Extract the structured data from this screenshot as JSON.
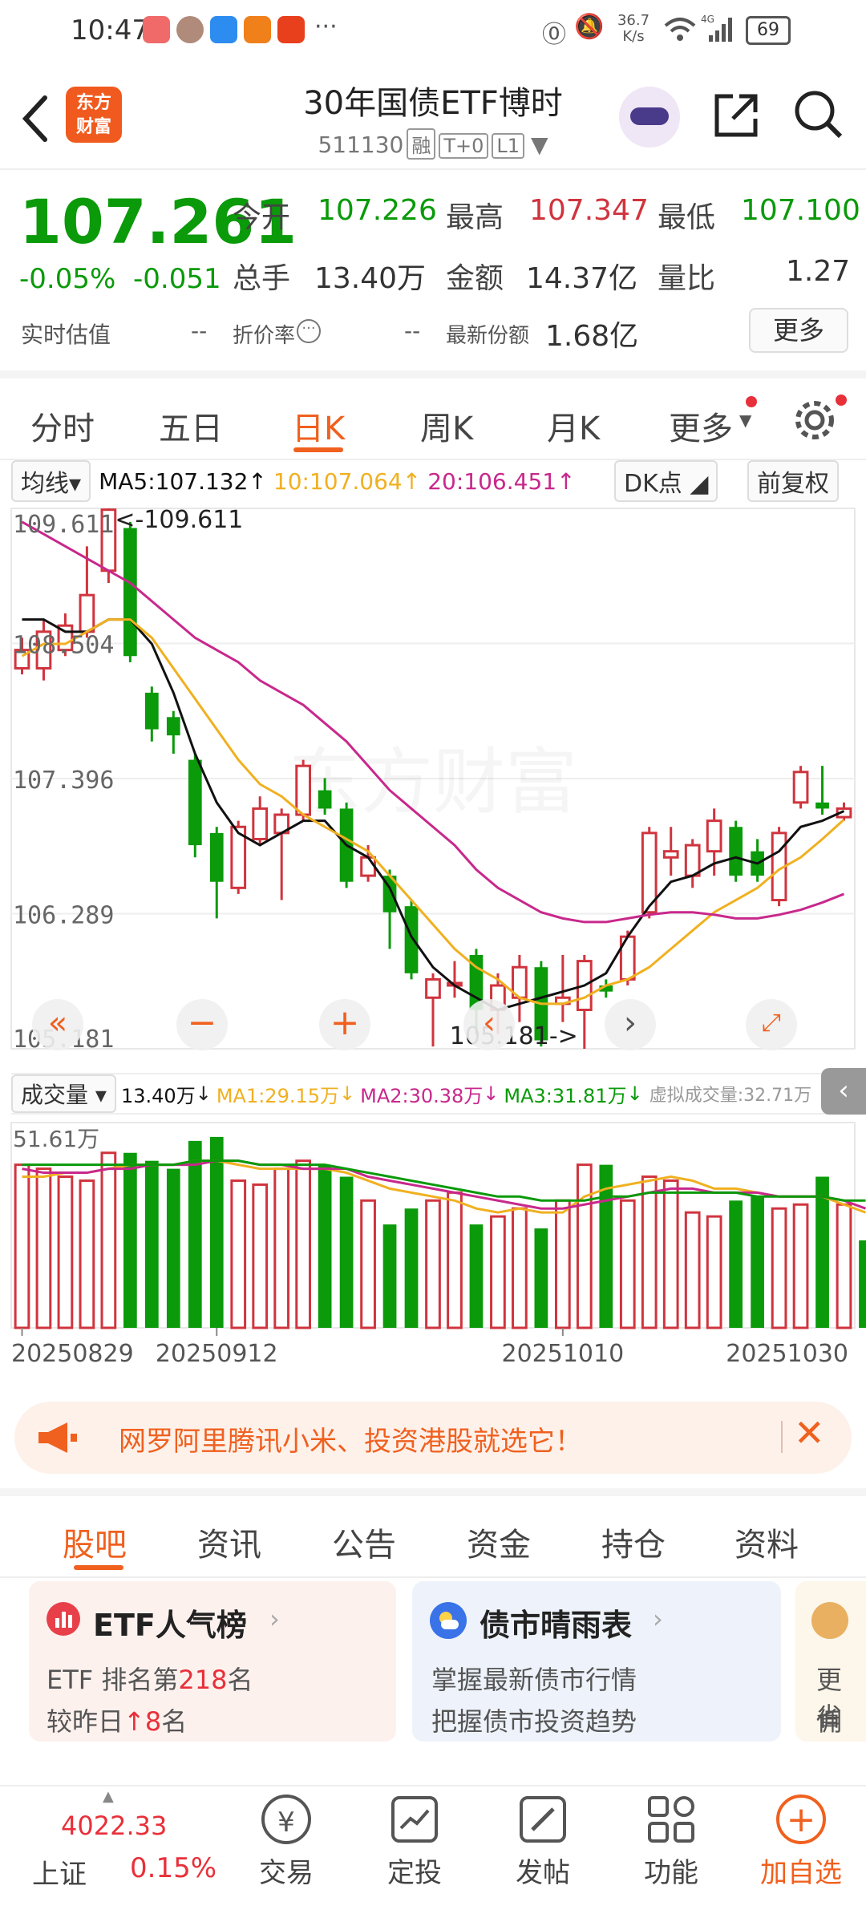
{
  "status_bar": {
    "time": "10:47",
    "net_speed_value": "36.7",
    "net_speed_unit": "K/s",
    "battery": "69"
  },
  "header": {
    "app_badge_line1": "东方",
    "app_badge_line2": "财富",
    "title": "30年国债ETF博时",
    "code": "511130",
    "tag1": "融",
    "tag2": "T+0",
    "tag3": "L1"
  },
  "quote": {
    "price": "107.261",
    "change_pct": "-0.05%",
    "change": "-0.051",
    "open_label": "今开",
    "open": "107.226",
    "high_label": "最高",
    "high": "107.347",
    "low_label": "最低",
    "low": "107.100",
    "volume_label": "总手",
    "volume": "13.40万",
    "amount_label": "金额",
    "amount": "14.37亿",
    "ratio_label": "量比",
    "ratio": "1.27",
    "estimate_label": "实时估值",
    "estimate": "--",
    "discount_label": "折价率",
    "discount": "--",
    "shares_label": "最新份额",
    "shares": "1.68亿",
    "more": "更多"
  },
  "chart_tabs": [
    "分时",
    "五日",
    "日K",
    "周K",
    "月K",
    "更多"
  ],
  "active_tab": 2,
  "kline_bar": {
    "ma_select": "均线",
    "ma5": "MA5:107.132",
    "ma10": "10:107.064",
    "ma20": "20:106.451",
    "dk": "DK点",
    "adjust": "前复权"
  },
  "volume_bar": {
    "select": "成交量",
    "vol": "13.40万",
    "ma1": "MA1:29.15万",
    "ma2": "MA2:30.38万",
    "ma3": "MA3:31.81万",
    "virtual": "虚拟成交量:32.71万"
  },
  "chart_data": {
    "type": "candlestick",
    "y_ticks": [
      "109.611",
      "108.504",
      "107.396",
      "106.289",
      "105.181"
    ],
    "ylim": [
      105.181,
      109.611
    ],
    "max_label": "<-109.611",
    "min_label": "105.181->",
    "vol_max_label": "51.61万",
    "vol_ylim": [
      0,
      51.61
    ],
    "x_labels": [
      "20250829",
      "20250912",
      "20251010",
      "20251030"
    ],
    "x_label_index": [
      0,
      9,
      25,
      40
    ],
    "candles": [
      {
        "o": 108.3,
        "c": 108.45,
        "h": 108.55,
        "l": 108.25
      },
      {
        "o": 108.3,
        "c": 108.6,
        "h": 108.7,
        "l": 108.2
      },
      {
        "o": 108.45,
        "c": 108.65,
        "h": 108.75,
        "l": 108.4
      },
      {
        "o": 108.6,
        "c": 108.9,
        "h": 109.3,
        "l": 108.55
      },
      {
        "o": 109.1,
        "c": 109.6,
        "h": 109.611,
        "l": 109.0
      },
      {
        "o": 109.45,
        "c": 108.4,
        "h": 109.5,
        "l": 108.35
      },
      {
        "o": 108.1,
        "c": 107.8,
        "h": 108.15,
        "l": 107.7
      },
      {
        "o": 107.9,
        "c": 107.75,
        "h": 107.95,
        "l": 107.6
      },
      {
        "o": 107.55,
        "c": 106.85,
        "h": 107.6,
        "l": 106.75
      },
      {
        "o": 106.95,
        "c": 106.55,
        "h": 107.0,
        "l": 106.25
      },
      {
        "o": 106.5,
        "c": 107.0,
        "h": 107.05,
        "l": 106.45
      },
      {
        "o": 106.9,
        "c": 107.15,
        "h": 107.25,
        "l": 106.85
      },
      {
        "o": 106.95,
        "c": 107.1,
        "h": 107.15,
        "l": 106.4
      },
      {
        "o": 107.1,
        "c": 107.5,
        "h": 107.55,
        "l": 107.05
      },
      {
        "o": 107.3,
        "c": 107.15,
        "h": 107.4,
        "l": 107.1
      },
      {
        "o": 107.15,
        "c": 106.55,
        "h": 107.2,
        "l": 106.5
      },
      {
        "o": 106.6,
        "c": 106.75,
        "h": 106.85,
        "l": 106.55
      },
      {
        "o": 106.6,
        "c": 106.3,
        "h": 106.65,
        "l": 106.0
      },
      {
        "o": 106.35,
        "c": 105.8,
        "h": 106.4,
        "l": 105.75
      },
      {
        "o": 105.6,
        "c": 105.75,
        "h": 105.8,
        "l": 105.2
      },
      {
        "o": 105.7,
        "c": 105.72,
        "h": 105.9,
        "l": 105.6
      },
      {
        "o": 105.95,
        "c": 105.5,
        "h": 106.0,
        "l": 105.3
      },
      {
        "o": 105.5,
        "c": 105.7,
        "h": 105.8,
        "l": 105.3
      },
      {
        "o": 105.6,
        "c": 105.85,
        "h": 105.95,
        "l": 105.4
      },
      {
        "o": 105.85,
        "c": 105.25,
        "h": 105.9,
        "l": 105.2
      },
      {
        "o": 105.55,
        "c": 105.6,
        "h": 105.95,
        "l": 105.4
      },
      {
        "o": 105.5,
        "c": 105.9,
        "h": 105.95,
        "l": 105.181
      },
      {
        "o": 105.7,
        "c": 105.65,
        "h": 105.75,
        "l": 105.6
      },
      {
        "o": 105.75,
        "c": 106.1,
        "h": 106.15,
        "l": 105.7
      },
      {
        "o": 106.3,
        "c": 106.95,
        "h": 107.0,
        "l": 106.25
      },
      {
        "o": 106.75,
        "c": 106.8,
        "h": 107.0,
        "l": 106.6
      },
      {
        "o": 106.6,
        "c": 106.85,
        "h": 106.9,
        "l": 106.5
      },
      {
        "o": 106.8,
        "c": 107.05,
        "h": 107.15,
        "l": 106.6
      },
      {
        "o": 107.0,
        "c": 106.6,
        "h": 107.05,
        "l": 106.55
      },
      {
        "o": 106.8,
        "c": 106.6,
        "h": 106.9,
        "l": 106.55
      },
      {
        "o": 106.4,
        "c": 106.95,
        "h": 107.0,
        "l": 106.35
      },
      {
        "o": 107.2,
        "c": 107.45,
        "h": 107.5,
        "l": 107.15
      },
      {
        "o": 107.2,
        "c": 107.15,
        "h": 107.5,
        "l": 107.1
      },
      {
        "o": 107.08,
        "c": 107.15,
        "h": 107.2,
        "l": 107.05
      }
    ],
    "volumes": [
      41,
      40,
      38,
      37,
      44,
      44,
      42,
      40,
      47,
      48,
      37,
      36,
      40,
      42,
      41,
      38,
      32,
      26,
      30,
      32,
      34,
      26,
      28,
      30,
      25,
      32,
      41,
      41,
      32,
      38,
      37,
      29,
      28,
      32,
      33,
      30,
      31,
      38,
      31,
      22
    ],
    "ma_series": [
      {
        "name": "MA5",
        "color": "#111111",
        "values": [
          108.7,
          108.7,
          108.6,
          108.6,
          108.7,
          108.7,
          108.5,
          108.1,
          107.6,
          107.2,
          106.95,
          106.85,
          106.95,
          107.05,
          107.05,
          106.85,
          106.75,
          106.5,
          106.1,
          105.85,
          105.7,
          105.6,
          105.5,
          105.55,
          105.6,
          105.65,
          105.7,
          105.8,
          106.1,
          106.35,
          106.55,
          106.6,
          106.7,
          106.75,
          106.7,
          106.8,
          107.0,
          107.05,
          107.13
        ]
      },
      {
        "name": "MA10",
        "color": "#f0b020",
        "values": [
          108.4,
          108.5,
          108.5,
          108.6,
          108.7,
          108.7,
          108.55,
          108.3,
          108.05,
          107.8,
          107.55,
          107.35,
          107.25,
          107.1,
          107.0,
          106.9,
          106.8,
          106.6,
          106.4,
          106.2,
          106.0,
          105.85,
          105.75,
          105.6,
          105.55,
          105.55,
          105.6,
          105.7,
          105.75,
          105.85,
          106.0,
          106.15,
          106.3,
          106.4,
          106.5,
          106.65,
          106.75,
          106.9,
          107.06
        ]
      },
      {
        "name": "MA20",
        "color": "#c8288c",
        "values": [
          109.5,
          109.4,
          109.3,
          109.2,
          109.1,
          109.0,
          108.85,
          108.7,
          108.55,
          108.45,
          108.35,
          108.2,
          108.1,
          108.0,
          107.85,
          107.7,
          107.5,
          107.3,
          107.15,
          107.0,
          106.85,
          106.65,
          106.5,
          106.4,
          106.3,
          106.25,
          106.22,
          106.22,
          106.25,
          106.28,
          106.3,
          106.3,
          106.28,
          106.25,
          106.25,
          106.28,
          106.32,
          106.38,
          106.45
        ]
      }
    ],
    "vol_ma_series": [
      {
        "name": "MA1",
        "color": "#f0b020",
        "values": [
          38,
          38,
          39,
          39,
          40,
          41,
          41,
          41,
          42,
          42,
          41,
          40,
          40,
          40,
          40,
          39,
          37,
          35,
          34,
          33,
          32,
          30,
          29,
          30,
          29,
          29,
          33,
          35,
          36,
          37,
          38,
          37,
          35,
          35,
          34,
          33,
          33,
          33,
          31,
          29
        ]
      },
      {
        "name": "MA2",
        "color": "#c8288c",
        "values": [
          40,
          39,
          39,
          39,
          40,
          40,
          41,
          41,
          41,
          42,
          42,
          41,
          41,
          40,
          40,
          40,
          38,
          37,
          36,
          35,
          34,
          33,
          32,
          31,
          30,
          30,
          31,
          32,
          33,
          34,
          35,
          35,
          34,
          34,
          34,
          33,
          33,
          33,
          32,
          30
        ]
      },
      {
        "name": "MA3",
        "color": "#0a9a0a",
        "values": [
          41,
          41,
          41,
          41,
          41,
          41,
          41,
          41,
          42,
          42,
          42,
          41,
          41,
          41,
          41,
          40,
          39,
          38,
          37,
          36,
          35,
          34,
          33,
          33,
          32,
          32,
          32,
          33,
          33,
          34,
          34,
          34,
          34,
          34,
          33,
          33,
          33,
          33,
          32,
          32
        ]
      }
    ]
  },
  "ad_banner": {
    "text": "网罗阿里腾讯小米、投资港股就选它！"
  },
  "content_tabs": [
    "股吧",
    "资讯",
    "公告",
    "资金",
    "持仓",
    "资料"
  ],
  "cards": [
    {
      "title": "ETF人气榜",
      "line1_prefix": "ETF 排名第",
      "line1_num": "218",
      "line1_suffix": "名",
      "line2_prefix": "较昨日",
      "line2_num": "8",
      "line2_suffix": "名"
    },
    {
      "title": "债市晴雨表",
      "line1": "掌握最新债市行情",
      "line2": "把握债市投资趋势"
    },
    {
      "line1": "更省",
      "line2": "佣金"
    }
  ],
  "bottom_nav": {
    "index_value": "4022.33",
    "index_name": "上证",
    "index_change": "0.15%",
    "items": [
      "交易",
      "定投",
      "发帖",
      "功能",
      "加自选"
    ]
  }
}
